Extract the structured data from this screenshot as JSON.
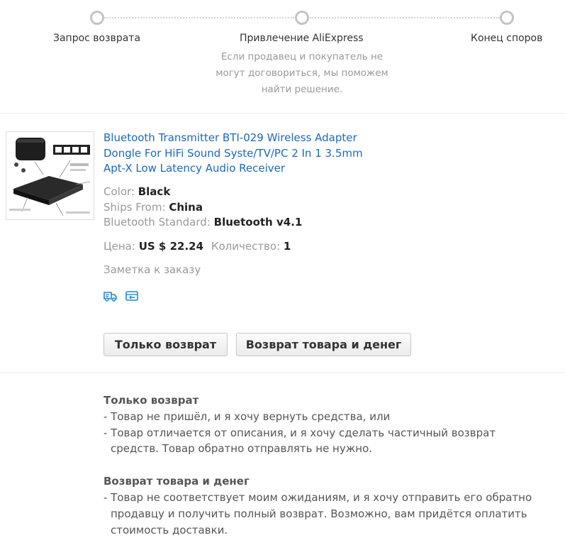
{
  "steps": [
    {
      "label": "Запрос возврата"
    },
    {
      "label": "Привлечение AliExpress",
      "description": "Если продавец и покупатель не могут договориться, мы поможем найти решение."
    },
    {
      "label": "Конец споров"
    }
  ],
  "product": {
    "image_alt": "Bluetooth transmitter product image",
    "title": "Bluetooth Transmitter BTI-029 Wireless Adapter Dongle For HiFi Sound Syste/TV/PC 2 In 1 3.5mm Apt-X Low Latency Audio Receiver",
    "attributes": [
      {
        "key": "Color:",
        "value": "Black"
      },
      {
        "key": "Ships From:",
        "value": "China"
      },
      {
        "key": "Bluetooth Standard:",
        "value": "Bluetooth v4.1"
      }
    ],
    "price_label": "Цена:",
    "price_value": "US $ 22.24",
    "qty_label": "Количество:",
    "qty_value": "1",
    "note": "Заметка к заказу",
    "icons": [
      "delivery-truck-icon",
      "return-order-icon"
    ],
    "accent_color": "#1a8bd4"
  },
  "buttons": {
    "refund_only": "Только возврат",
    "return_and_refund": "Возврат товара и денег"
  },
  "info": {
    "refund_only_title": "Только возврат",
    "refund_only_items": [
      "- Товар не пришёл, и я хочу вернуть средства, или",
      "- Товар отличается от описания, и я хочу сделать частичный возврат средств. Товар обратно отправлять не нужно."
    ],
    "return_title": "Возврат товара и денег",
    "return_items": [
      "- Товар не соответствует моим ожиданиям, и я хочу отправить его обратно продавцу и получить полный возврат. Возможно, вам придётся оплатить стоимость доставки."
    ]
  }
}
